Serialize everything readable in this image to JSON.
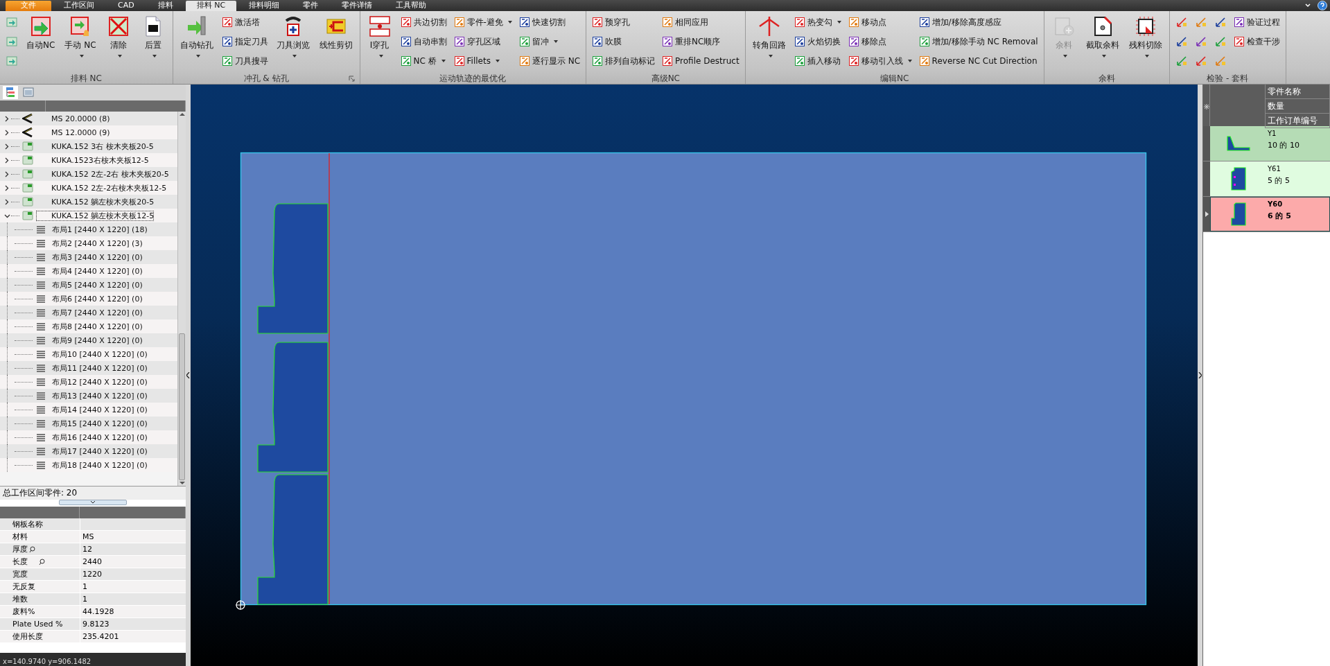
{
  "menu_tabs": [
    {
      "label": "文件",
      "kind": "file",
      "selected": false
    },
    {
      "label": "工作区间",
      "kind": "tab",
      "selected": false
    },
    {
      "label": "CAD",
      "kind": "tab",
      "selected": false
    },
    {
      "label": "排料",
      "kind": "tab",
      "selected": false
    },
    {
      "label": "排料 NC",
      "kind": "tab",
      "selected": true
    },
    {
      "label": "排料明细",
      "kind": "tab",
      "selected": false
    },
    {
      "label": "零件",
      "kind": "tab",
      "selected": false
    },
    {
      "label": "零件详情",
      "kind": "tab",
      "selected": false
    },
    {
      "label": "工具帮助",
      "kind": "tab",
      "selected": false
    }
  ],
  "ribbon": [
    {
      "label": "排料 NC",
      "launcher": false,
      "items": [
        {
          "kind": "icon",
          "disabled": false
        },
        {
          "kind": "icon",
          "disabled": false
        },
        {
          "kind": "icon",
          "disabled": false
        },
        {
          "kind": "large",
          "label": "自动NC",
          "dropdown": false,
          "disabled": false
        },
        {
          "kind": "large",
          "label": "手动 NC",
          "dropdown": true,
          "disabled": false
        },
        {
          "kind": "large",
          "label": "清除",
          "dropdown": true,
          "disabled": false
        },
        {
          "kind": "large",
          "label": "后置",
          "dropdown": true,
          "disabled": false
        }
      ]
    },
    {
      "label": "冲孔 & 钻孔",
      "launcher": true,
      "items": [
        {
          "kind": "large",
          "label": "自动钻孔",
          "dropdown": true,
          "disabled": false
        },
        {
          "kind": "small",
          "label": "激活塔",
          "dropdown": false,
          "disabled": false
        },
        {
          "kind": "small",
          "label": "指定刀具",
          "dropdown": false,
          "disabled": false
        },
        {
          "kind": "small",
          "label": "刀具搜寻",
          "dropdown": false,
          "disabled": false
        },
        {
          "kind": "large",
          "label": "刀具浏览",
          "dropdown": true,
          "disabled": false
        },
        {
          "kind": "large",
          "label": "线性剪切",
          "dropdown": false,
          "disabled": false
        }
      ]
    },
    {
      "label": "运动轨迹的最优化",
      "launcher": false,
      "items": [
        {
          "kind": "large",
          "label": "I穿孔",
          "dropdown": true,
          "disabled": false
        },
        {
          "kind": "small",
          "label": "共边切割",
          "dropdown": false,
          "disabled": false
        },
        {
          "kind": "small",
          "label": "自动串割",
          "dropdown": false,
          "disabled": false
        },
        {
          "kind": "small",
          "label": "NC 桥",
          "dropdown": true,
          "disabled": false
        },
        {
          "kind": "small",
          "label": "零件-避免",
          "dropdown": true,
          "disabled": false
        },
        {
          "kind": "small",
          "label": "穿孔区域",
          "dropdown": false,
          "disabled": false
        },
        {
          "kind": "small",
          "label": "Fillets",
          "dropdown": true,
          "disabled": false
        },
        {
          "kind": "small",
          "label": "快速切割",
          "dropdown": false,
          "disabled": false
        },
        {
          "kind": "small",
          "label": "留冲",
          "dropdown": true,
          "disabled": false
        },
        {
          "kind": "small",
          "label": "逐行显示 NC",
          "dropdown": false,
          "disabled": false
        }
      ]
    },
    {
      "label": "高级NC",
      "launcher": false,
      "items": [
        {
          "kind": "small",
          "label": "预穿孔",
          "dropdown": false,
          "disabled": false
        },
        {
          "kind": "small",
          "label": "吹膜",
          "dropdown": false,
          "disabled": false
        },
        {
          "kind": "small",
          "label": "排列自动标记",
          "dropdown": false,
          "disabled": false
        },
        {
          "kind": "small",
          "label": "相同应用",
          "dropdown": false,
          "disabled": false
        },
        {
          "kind": "small",
          "label": "重排NC顺序",
          "dropdown": false,
          "disabled": false
        },
        {
          "kind": "small",
          "label": "Profile Destruct",
          "dropdown": false,
          "disabled": false
        }
      ]
    },
    {
      "label": "编辑NC",
      "launcher": false,
      "items": [
        {
          "kind": "large",
          "label": "转角回路",
          "dropdown": true,
          "disabled": false
        },
        {
          "kind": "small",
          "label": "热变勾",
          "dropdown": true,
          "disabled": false
        },
        {
          "kind": "small",
          "label": "火焰切换",
          "dropdown": false,
          "disabled": false
        },
        {
          "kind": "small",
          "label": "插入移动",
          "dropdown": false,
          "disabled": false
        },
        {
          "kind": "small",
          "label": "移动点",
          "dropdown": false,
          "disabled": false
        },
        {
          "kind": "small",
          "label": "移除点",
          "dropdown": false,
          "disabled": false
        },
        {
          "kind": "small",
          "label": "移动引入线",
          "dropdown": true,
          "disabled": false
        },
        {
          "kind": "small",
          "label": "增加/移除高度感应",
          "dropdown": false,
          "disabled": false
        },
        {
          "kind": "small",
          "label": "增加/移除手动 NC Removal",
          "dropdown": false,
          "disabled": false
        },
        {
          "kind": "small",
          "label": "Reverse NC Cut Direction",
          "dropdown": false,
          "disabled": false
        }
      ]
    },
    {
      "label": "余料",
      "launcher": false,
      "items": [
        {
          "kind": "large",
          "label": "余料",
          "dropdown": true,
          "disabled": true
        },
        {
          "kind": "large",
          "label": "截取余料",
          "dropdown": true,
          "disabled": false
        },
        {
          "kind": "large",
          "label": "残料切除",
          "dropdown": true,
          "disabled": false
        }
      ]
    },
    {
      "label": "检验 - 套料",
      "launcher": false,
      "items": [
        {
          "kind": "icon",
          "disabled": false
        },
        {
          "kind": "icon",
          "disabled": false
        },
        {
          "kind": "icon",
          "disabled": false
        },
        {
          "kind": "icon",
          "disabled": false
        },
        {
          "kind": "icon",
          "disabled": false
        },
        {
          "kind": "icon",
          "disabled": false
        },
        {
          "kind": "icon",
          "disabled": false
        },
        {
          "kind": "icon",
          "disabled": false
        },
        {
          "kind": "icon",
          "disabled": false
        },
        {
          "kind": "small",
          "label": "验证过程",
          "dropdown": false,
          "disabled": false
        },
        {
          "kind": "small",
          "label": "检查干涉",
          "dropdown": false,
          "disabled": false
        }
      ]
    }
  ],
  "tree": [
    {
      "label": "MS 20.0000 (8)",
      "kind": "material",
      "expanded": false,
      "selected": false
    },
    {
      "label": "MS 12.0000 (9)",
      "kind": "material",
      "expanded": false,
      "selected": false
    },
    {
      "label": "KUKA.152 3右 桉木夹板20-5",
      "kind": "sheet",
      "expanded": false,
      "selected": false
    },
    {
      "label": "KUKA.1523右桉木夹板12-5",
      "kind": "sheet",
      "expanded": false,
      "selected": false
    },
    {
      "label": "KUKA.152 2左-2右 桉木夹板20-5",
      "kind": "sheet",
      "expanded": false,
      "selected": false
    },
    {
      "label": "KUKA.152  2左-2右桉木夹板12-5",
      "kind": "sheet",
      "expanded": false,
      "selected": false
    },
    {
      "label": "KUKA.152  躺左桉木夹板20-5",
      "kind": "sheet",
      "expanded": false,
      "selected": false
    },
    {
      "label": "KUKA.152  躺左桉木夹板12-5",
      "kind": "sheet",
      "expanded": true,
      "selected": true,
      "children": [
        {
          "label": "布局1 [2440 X 1220]  (18)"
        },
        {
          "label": "布局2 [2440 X 1220]  (3)"
        },
        {
          "label": "布局3 [2440 X 1220]  (0)"
        },
        {
          "label": "布局4 [2440 X 1220]  (0)"
        },
        {
          "label": "布局5 [2440 X 1220]  (0)"
        },
        {
          "label": "布局6 [2440 X 1220]  (0)"
        },
        {
          "label": "布局7 [2440 X 1220]  (0)"
        },
        {
          "label": "布局8 [2440 X 1220]  (0)"
        },
        {
          "label": "布局9 [2440 X 1220]  (0)"
        },
        {
          "label": "布局10 [2440 X 1220]  (0)"
        },
        {
          "label": "布局11 [2440 X 1220]  (0)"
        },
        {
          "label": "布局12 [2440 X 1220]  (0)"
        },
        {
          "label": "布局13 [2440 X 1220]  (0)"
        },
        {
          "label": "布局14 [2440 X 1220]  (0)"
        },
        {
          "label": "布局15 [2440 X 1220]  (0)"
        },
        {
          "label": "布局16 [2440 X 1220]  (0)"
        },
        {
          "label": "布局17 [2440 X 1220]  (0)"
        },
        {
          "label": "布局18 [2440 X 1220]  (0)"
        }
      ]
    }
  ],
  "workspace_total": "总工作区间零件: 20",
  "properties": [
    {
      "label": "钢板名称",
      "search": false
    },
    {
      "label": "材料",
      "value": "MS",
      "search": false
    },
    {
      "label": "厚度",
      "value": "12",
      "search": true
    },
    {
      "label": "长度",
      "value": "2440",
      "search": true
    },
    {
      "label": "宽度",
      "value": "1220",
      "search": false
    },
    {
      "label": "无反复",
      "value": "1",
      "search": false
    },
    {
      "label": "堆数",
      "value": "1",
      "search": false
    },
    {
      "label": "废料%",
      "value": "44.1928",
      "search": false
    },
    {
      "label": "Plate Used %",
      "value": "9.8123",
      "search": false
    },
    {
      "label": "使用长度",
      "value": "235.4201",
      "search": false
    }
  ],
  "status_bar": "x=140.9740 y=906.1482",
  "parts_panel": {
    "columns": [
      "零件名称",
      "数量",
      "工作订单编号"
    ],
    "rows": [
      {
        "name": "Y1",
        "count": "10 的 10",
        "color": "#b5dcb5",
        "selected": false,
        "kind": "angle"
      },
      {
        "name": "Y61",
        "count": "5 的 5",
        "color": "#e0fce0",
        "selected": false,
        "kind": "block"
      },
      {
        "name": "Y60",
        "count": "6 的 5",
        "color": "#fcaaaa",
        "selected": true,
        "kind": "step"
      }
    ]
  }
}
